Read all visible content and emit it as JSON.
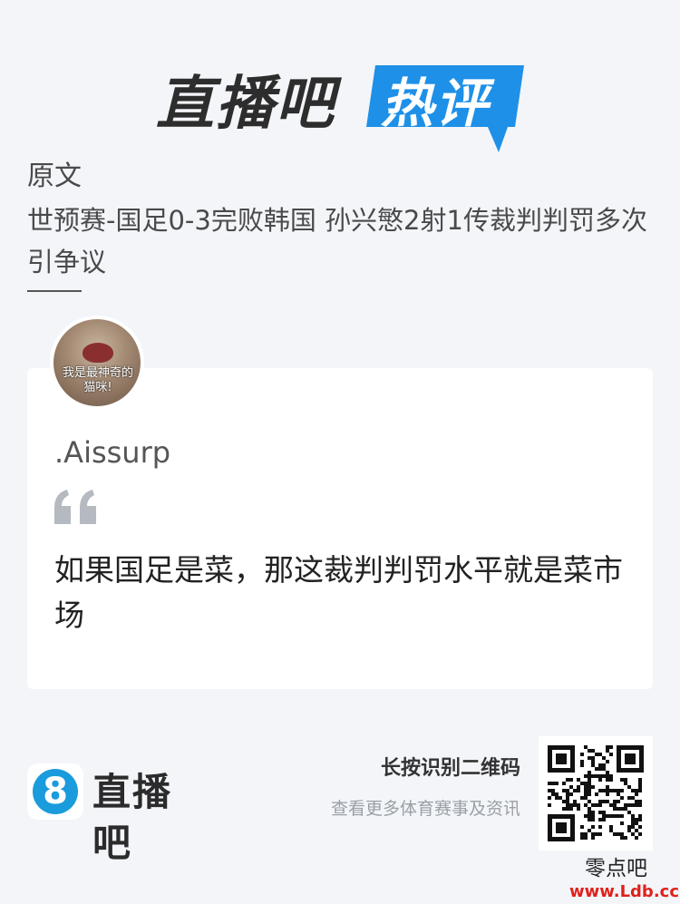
{
  "header": {
    "brand": "直播吧",
    "badge": "热评",
    "badge_color": "#1e90e8"
  },
  "original": {
    "label": "原文",
    "title": "世预赛-国足0-3完败韩国 孙兴慜2射1传裁判判罚多次引争议"
  },
  "comment": {
    "avatar_caption": "我是最神奇的猫咪!",
    "username": ".Aissurp",
    "text": "如果国足是菜，那这裁判判罚水平就是菜市场"
  },
  "footer": {
    "badge_number": "8",
    "brand": "直播吧",
    "scan_label": "长按识别二维码",
    "scan_sub": "查看更多体育赛事及资讯"
  },
  "watermark": {
    "name": "零点吧",
    "url": "www.Ldb.cc"
  },
  "colors": {
    "background": "#f3f5f9",
    "accent": "#1e90e8",
    "footer_badge": "#1a9bdc"
  }
}
